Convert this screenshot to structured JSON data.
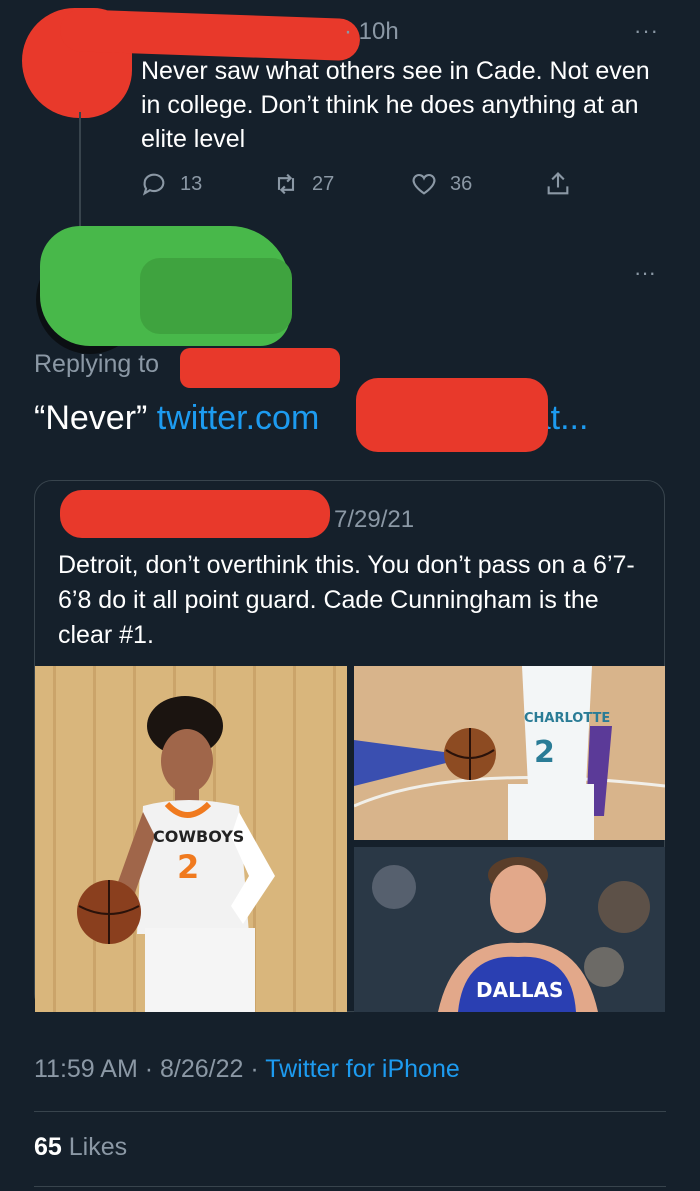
{
  "parent_tweet": {
    "time": "· 10h",
    "more": "···",
    "text": "Never saw what others see in Cade. Not even in college. Don’t think he does anything at an elite level",
    "actions": {
      "replies": "13",
      "retweets": "27",
      "likes": "36"
    }
  },
  "main_tweet": {
    "more": "···",
    "replying_prefix": "Replying to",
    "text_quote": "“Never”",
    "link_start": "twitter.com",
    "link_end": "stat...",
    "quote": {
      "date": "7/29/21",
      "text": "Detroit, don’t overthink this. You don’t pass on a 6’7-6’8 do it all point guard.  Cade Cunningham is the clear #1."
    },
    "footer": {
      "time": "11:59 AM",
      "separator": "·",
      "date": "8/26/22",
      "source": "Twitter for iPhone"
    },
    "likes_count": "65",
    "likes_label": "Likes"
  },
  "photos": {
    "photo1": {
      "jersey_team": "COWBOYS",
      "jersey_number": "2"
    },
    "photo2": {
      "jersey_team": "CHARLOTTE",
      "jersey_number": "2"
    },
    "photo3": {
      "jersey_team": "DALLAS"
    }
  },
  "colors": {
    "background": "#15202b",
    "link": "#1d9bf0",
    "muted": "#8b98a5",
    "border": "#38444d"
  }
}
